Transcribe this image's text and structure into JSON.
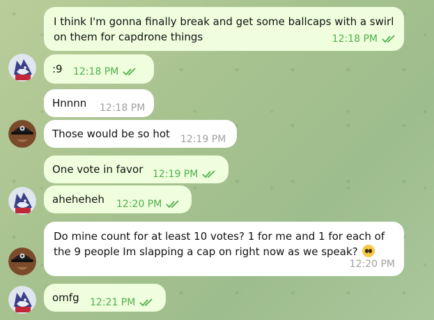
{
  "messages": [
    {
      "text": "I think I'm gonna finally break and get some ballcaps with a swirl\non them for capdrone things",
      "time": "12:18 PM",
      "direction": "outgoing",
      "read": true
    },
    {
      "text": ":9",
      "time": "12:18 PM",
      "direction": "outgoing",
      "read": true,
      "avatar": "wolf-avatar"
    },
    {
      "text": "Hnnnn",
      "time": "12:18 PM",
      "direction": "incoming"
    },
    {
      "text": "Those would be so hot",
      "time": "12:19 PM",
      "direction": "incoming",
      "avatar": "cap-avatar"
    },
    {
      "text": "One vote in favor",
      "time": "12:19 PM",
      "direction": "outgoing",
      "read": true
    },
    {
      "text": "aheheheh",
      "time": "12:20 PM",
      "direction": "outgoing",
      "read": true,
      "avatar": "wolf-avatar"
    },
    {
      "text": "Do mine count for at least 10 votes? 1 for me and 1 for each of\nthe 9 people Im slapping a cap on right now as we speak?",
      "emoji": "pleading-face",
      "time": "12:20 PM",
      "direction": "incoming",
      "avatar": "cap-avatar"
    },
    {
      "text": "omfg",
      "time": "12:21 PM",
      "direction": "outgoing",
      "read": true,
      "avatar": "wolf-avatar"
    }
  ],
  "colors": {
    "outgoing_bubble": "#effedd",
    "incoming_bubble": "#ffffff",
    "outgoing_meta": "#4fae4e",
    "incoming_meta": "#a0a0a0"
  }
}
